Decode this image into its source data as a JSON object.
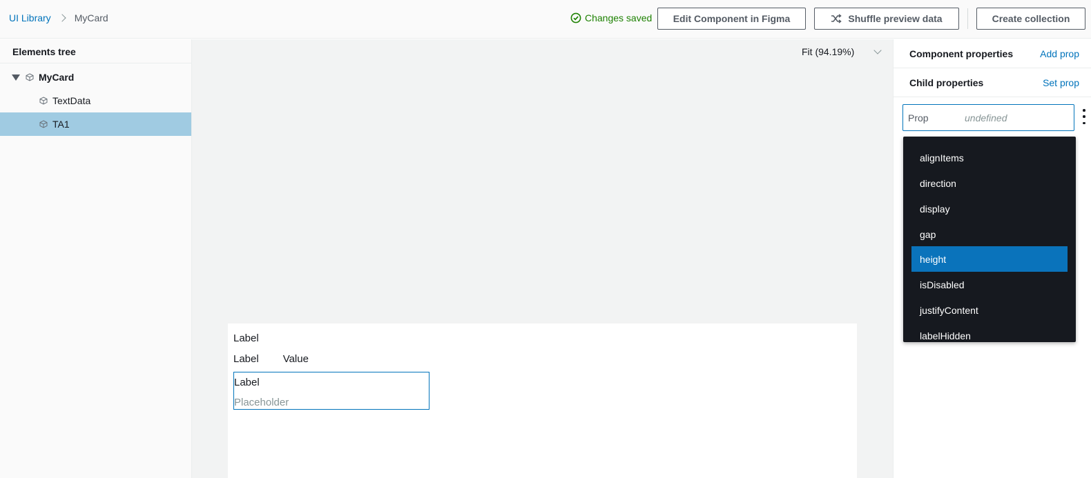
{
  "breadcrumb": {
    "root": "UI Library",
    "current": "MyCard"
  },
  "status": {
    "saved": "Changes saved",
    "color": "#1d8102"
  },
  "toolbar": {
    "edit_figma": "Edit Component in Figma",
    "shuffle": "Shuffle preview data",
    "create_collection": "Create collection"
  },
  "elements_tree": {
    "title": "Elements tree",
    "items": [
      {
        "label": "MyCard",
        "expanded": true,
        "selected": false
      },
      {
        "label": "TextData",
        "selected": false
      },
      {
        "label": "TA1",
        "selected": true
      }
    ]
  },
  "canvas": {
    "zoom": "Fit (94.19%)",
    "card": {
      "label1": "Label",
      "row2_label": "Label",
      "row2_value": "Value",
      "field_label": "Label",
      "field_placeholder": "Placeholder"
    }
  },
  "right_panel": {
    "component_properties": "Component properties",
    "add_prop": "Add prop",
    "child_properties": "Child properties",
    "set_prop": "Set prop",
    "prop_input": {
      "name": "Prop",
      "value": "undefined"
    },
    "dropdown": {
      "options": [
        "alignItems",
        "direction",
        "display",
        "gap",
        "height",
        "isDisabled",
        "justifyContent",
        "labelHidden"
      ],
      "highlighted": "height"
    }
  },
  "colors": {
    "accent": "#0073bb",
    "selected_row": "#a0cbe2",
    "dropdown_bg": "#16191f",
    "dropdown_highlight": "#0a73bb"
  }
}
